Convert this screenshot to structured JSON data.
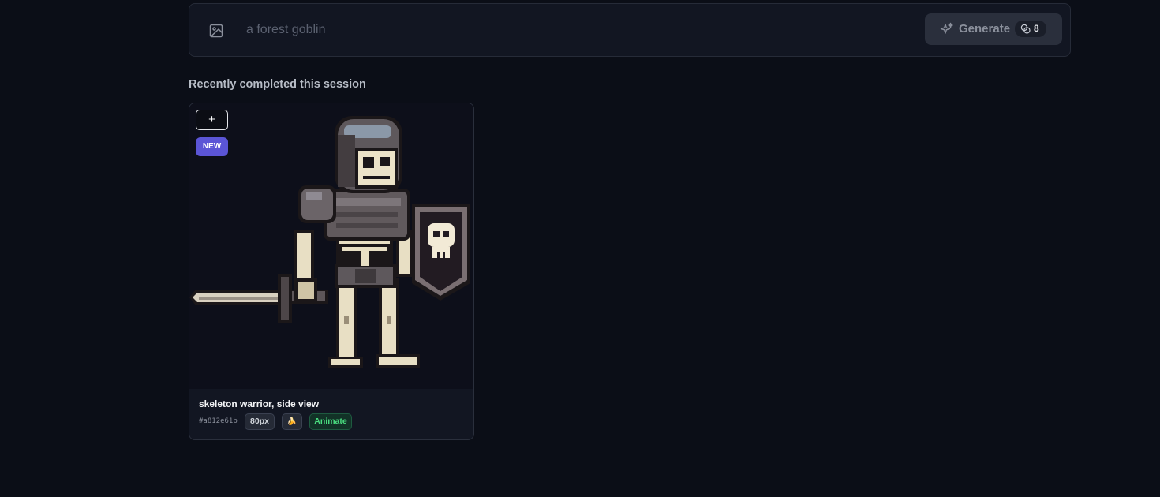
{
  "prompt_bar": {
    "upload_icon": "image-icon",
    "placeholder": "a forest goblin",
    "generate_label": "Generate",
    "generate_icon": "sparkles-icon",
    "credit_icon": "coins-icon",
    "credit_count": "8"
  },
  "session": {
    "heading": "Recently completed this session"
  },
  "cards": [
    {
      "add_label": "+",
      "badge": "NEW",
      "title": "skeleton warrior, side view",
      "hash": "#a812e61b",
      "size": "80px",
      "model_icon": "banana-icon",
      "model_glyph": "🍌",
      "animate_label": "Animate"
    }
  ],
  "colors": {
    "background": "#0b0e17",
    "panel": "#121622",
    "accent_badge": "#5b55d6",
    "animate_green": "#4ade80"
  }
}
